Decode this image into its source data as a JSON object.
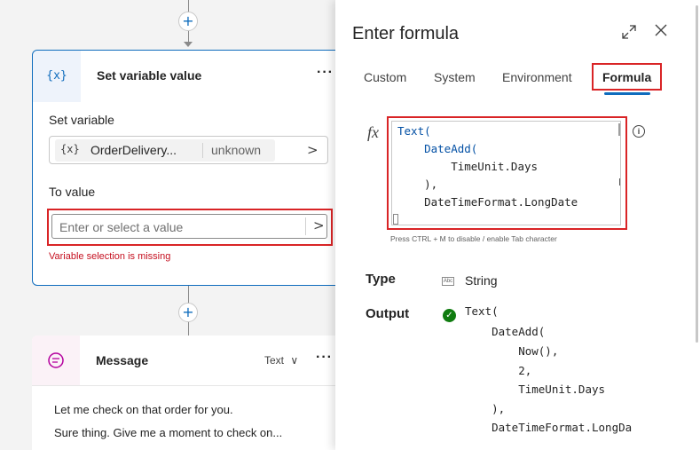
{
  "canvas": {
    "add_symbol": "+",
    "set_variable_node": {
      "icon_text": "{x}",
      "title": "Set variable value",
      "more": "···",
      "set_variable_label": "Set variable",
      "variable": {
        "icon_text": "{x}",
        "name": "OrderDelivery...",
        "type": "unknown",
        "chevron": ">"
      },
      "to_value_label": "To value",
      "value_placeholder": "Enter or select a value",
      "value_chevron": ">",
      "error": "Variable selection is missing"
    },
    "message_node": {
      "title": "Message",
      "type_label": "Text",
      "type_chevron": "∨",
      "more": "···",
      "lines": [
        "Let me check on that order for you.",
        "Sure thing. Give me a moment to check on..."
      ]
    }
  },
  "panel": {
    "title": "Enter formula",
    "expand_icon": "expand-icon",
    "close_icon": "close-icon",
    "tabs": [
      "Custom",
      "System",
      "Environment",
      "Formula"
    ],
    "active_tab": "Formula",
    "fx_label": "fx",
    "editor_lines": [
      "Text(",
      "    DateAdd(",
      "        TimeUnit.Days",
      "    ),",
      "    DateTimeFormat.LongDate"
    ],
    "hint": "Press CTRL + M to disable / enable Tab character",
    "type_label": "Type",
    "type_icon_text": "Abc",
    "type_value": "String",
    "output_label": "Output",
    "output_lines": [
      "Text(",
      "    DateAdd(",
      "        Now(),",
      "        2,",
      "        TimeUnit.Days",
      "    ),",
      "    DateTimeFormat.LongDa"
    ]
  },
  "colors": {
    "accent": "#0f6cbd",
    "highlight": "#d92426",
    "error": "#c50f1f",
    "success": "#107c10"
  }
}
